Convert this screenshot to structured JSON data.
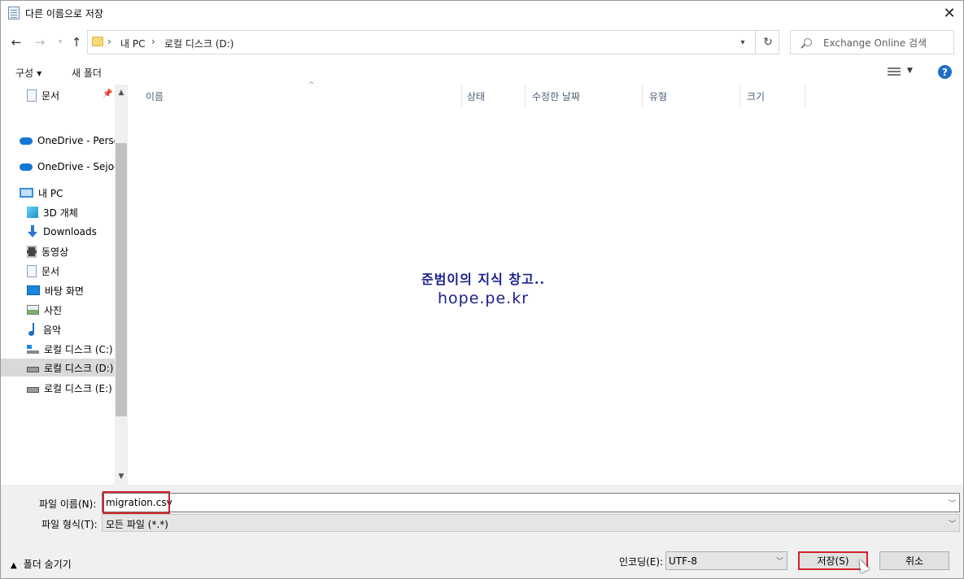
{
  "window": {
    "title": "다른 이름으로 저장"
  },
  "nav": {
    "breadcrumb": [
      "내 PC",
      "로컬 디스크 (D:)"
    ],
    "search_placeholder": "Exchange Online 검색"
  },
  "toolbar": {
    "organize": "구성",
    "new_folder": "새 폴더"
  },
  "sidebar": {
    "items": [
      {
        "label": "문서",
        "icon": "document-icon"
      },
      {
        "label": "OneDrive - Personal",
        "icon": "onedrive-icon"
      },
      {
        "label": "OneDrive - Sejoon",
        "icon": "onedrive-icon"
      },
      {
        "label": "내 PC",
        "icon": "pc-icon"
      },
      {
        "label": "3D 개체",
        "icon": "3d-objects-icon"
      },
      {
        "label": "Downloads",
        "icon": "downloads-icon"
      },
      {
        "label": "동영상",
        "icon": "videos-icon"
      },
      {
        "label": "문서",
        "icon": "document-icon"
      },
      {
        "label": "바탕 화면",
        "icon": "desktop-icon"
      },
      {
        "label": "사진",
        "icon": "pictures-icon"
      },
      {
        "label": "음악",
        "icon": "music-icon"
      },
      {
        "label": "로컬 디스크 (C:)",
        "icon": "system-drive-icon"
      },
      {
        "label": "로컬 디스크 (D:)",
        "icon": "drive-icon",
        "selected": true
      },
      {
        "label": "로컬 디스크 (E:)",
        "icon": "drive-icon"
      }
    ]
  },
  "filelist": {
    "columns": [
      "이름",
      "상태",
      "수정한 날짜",
      "유형",
      "크기"
    ],
    "watermark_line1": "준범이의 지식 창고..",
    "watermark_line2": "hope.pe.kr"
  },
  "form": {
    "filename_label": "파일 이름(N):",
    "filename_value": "migration.csv",
    "filetype_label": "파일 형식(T):",
    "filetype_value": "모든 파일 (*.*)",
    "hide_folders": "폴더 숨기기",
    "encoding_label": "인코딩(E):",
    "encoding_value": "UTF-8",
    "save": "저장(S)",
    "cancel": "취소"
  },
  "colors": {
    "highlight_red": "#d0232a",
    "help_blue": "#1d6fc6"
  }
}
